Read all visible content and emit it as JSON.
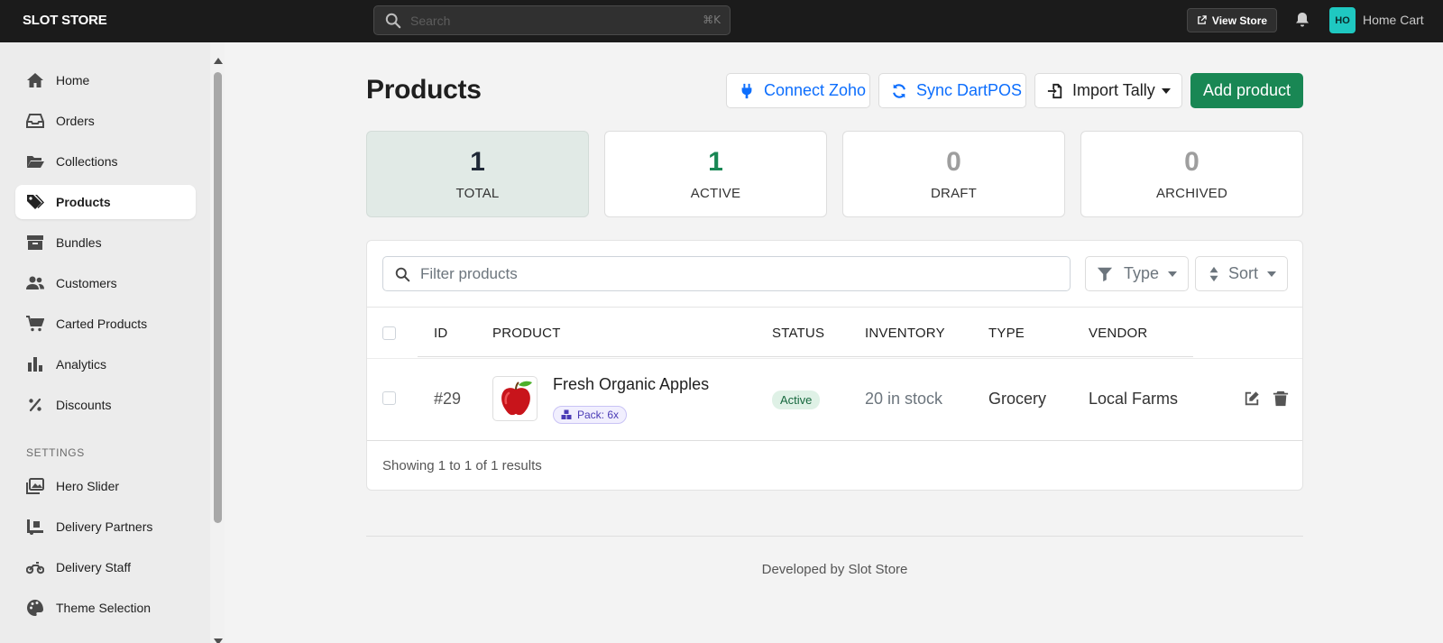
{
  "topbar": {
    "brand": "SLOT STORE",
    "search_placeholder": "Search",
    "shortcut": "⌘K",
    "view_store_label": "View Store",
    "avatar_initials": "HO",
    "store_name": "Home Cart"
  },
  "sidebar": {
    "items": [
      {
        "label": "Home",
        "icon": "home-icon"
      },
      {
        "label": "Orders",
        "icon": "inbox-icon"
      },
      {
        "label": "Collections",
        "icon": "folder-open-icon"
      },
      {
        "label": "Products",
        "icon": "tags-icon",
        "active": true
      },
      {
        "label": "Bundles",
        "icon": "archive-box-icon"
      },
      {
        "label": "Customers",
        "icon": "users-icon"
      },
      {
        "label": "Carted Products",
        "icon": "cart-icon"
      },
      {
        "label": "Analytics",
        "icon": "bar-chart-icon"
      },
      {
        "label": "Discounts",
        "icon": "percent-icon"
      }
    ],
    "settings_label": "SETTINGS",
    "settings_items": [
      {
        "label": "Hero Slider",
        "icon": "images-icon"
      },
      {
        "label": "Delivery Partners",
        "icon": "truck-ramp-icon"
      },
      {
        "label": "Delivery Staff",
        "icon": "motorcycle-icon"
      },
      {
        "label": "Theme Selection",
        "icon": "palette-icon"
      }
    ]
  },
  "main": {
    "title": "Products",
    "buttons": {
      "connect_zoho": "Connect Zoho",
      "sync_dartpos": "Sync DartPOS",
      "import_tally": "Import Tally",
      "add_product": "Add product"
    },
    "stats": [
      {
        "value": "1",
        "label": "TOTAL",
        "color": "#1f2937"
      },
      {
        "value": "1",
        "label": "ACTIVE",
        "color": "#198754"
      },
      {
        "value": "0",
        "label": "DRAFT",
        "color": "#9e9e9e"
      },
      {
        "value": "0",
        "label": "ARCHIVED",
        "color": "#9e9e9e"
      }
    ],
    "filter_placeholder": "Filter products",
    "type_label": "Type",
    "sort_label": "Sort",
    "columns": [
      "ID",
      "PRODUCT",
      "STATUS",
      "INVENTORY",
      "TYPE",
      "VENDOR"
    ],
    "rows": [
      {
        "id": "#29",
        "name": "Fresh Organic Apples",
        "pack": "Pack: 6x",
        "status": "Active",
        "inventory": "20 in stock",
        "type": "Grocery",
        "vendor": "Local Farms"
      }
    ],
    "showing_text": "Showing 1 to 1 of 1 results"
  },
  "footer": "Developed by Slot Store",
  "colors": {
    "primary_green": "#198754",
    "link_blue": "#0d6efd",
    "topbar_bg": "#1b1b1b",
    "avatar_teal": "#1fc8c1"
  }
}
